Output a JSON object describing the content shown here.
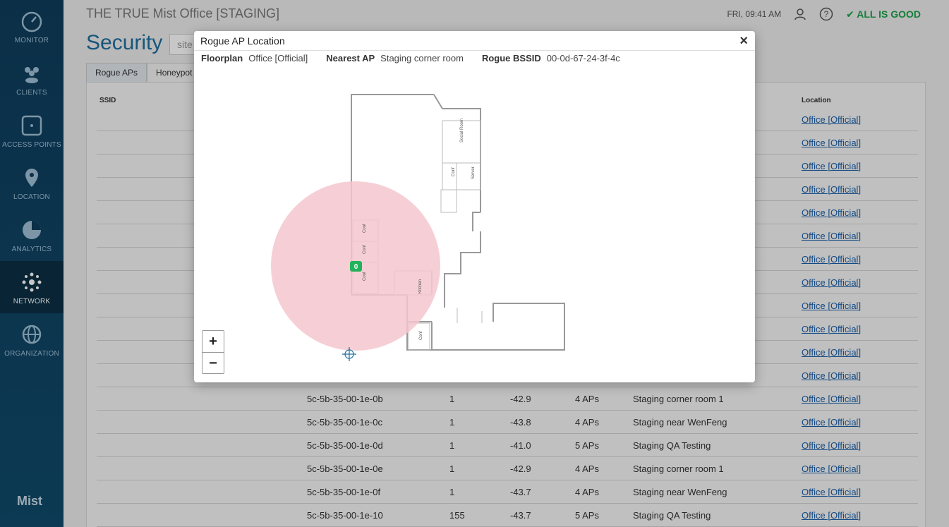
{
  "nav": [
    {
      "label": "MONITOR",
      "icon": "speedometer-icon"
    },
    {
      "label": "CLIENTS",
      "icon": "people-icon"
    },
    {
      "label": "ACCESS POINTS",
      "icon": "access-point-icon"
    },
    {
      "label": "LOCATION",
      "icon": "location-pin-icon"
    },
    {
      "label": "ANALYTICS",
      "icon": "pie-chart-icon"
    },
    {
      "label": "NETWORK",
      "icon": "network-icon"
    },
    {
      "label": "ORGANIZATION",
      "icon": "globe-icon"
    }
  ],
  "brand": "Mist",
  "header": {
    "site_title": "THE TRUE Mist Office [STAGING]",
    "datetime": "FRI, 09:41 AM",
    "status": "ALL IS GOOD"
  },
  "page": {
    "title": "Security",
    "site_placeholder": "site",
    "tabs": [
      "Rogue APs",
      "Honeypot"
    ]
  },
  "table": {
    "headers": {
      "ssid": "SSID",
      "location": "Location"
    },
    "rows": [
      {
        "bssid": "",
        "channel": "",
        "rssi": "",
        "aps": "",
        "closest": "",
        "location": "Office [Official]"
      },
      {
        "bssid": "",
        "channel": "",
        "rssi": "",
        "aps": "",
        "closest": "",
        "location": "Office [Official]"
      },
      {
        "bssid": "",
        "channel": "",
        "rssi": "",
        "aps": "",
        "closest": "",
        "location": "Office [Official]"
      },
      {
        "bssid": "",
        "channel": "",
        "rssi": "",
        "aps": "",
        "closest": "",
        "location": "Office [Official]"
      },
      {
        "bssid": "",
        "channel": "",
        "rssi": "",
        "aps": "",
        "closest": "",
        "location": "Office [Official]"
      },
      {
        "bssid": "",
        "channel": "",
        "rssi": "",
        "aps": "",
        "closest": "",
        "location": "Office [Official]"
      },
      {
        "bssid": "",
        "channel": "",
        "rssi": "",
        "aps": "",
        "closest": "",
        "location": "Office [Official]"
      },
      {
        "bssid": "",
        "channel": "",
        "rssi": "",
        "aps": "",
        "closest": "",
        "location": "Office [Official]"
      },
      {
        "bssid": "",
        "channel": "",
        "rssi": "",
        "aps": "",
        "closest": "",
        "location": "Office [Official]"
      },
      {
        "bssid": "",
        "channel": "",
        "rssi": "",
        "aps": "",
        "closest": "",
        "location": "Office [Official]"
      },
      {
        "bssid": "",
        "channel": "",
        "rssi": "",
        "aps": "",
        "closest": "",
        "location": "Office [Official]"
      },
      {
        "bssid": "",
        "channel": "",
        "rssi": "",
        "aps": "",
        "closest": "",
        "location": "Office [Official]"
      },
      {
        "bssid": "5c-5b-35-00-1e-0b",
        "channel": "1",
        "rssi": "-42.9",
        "aps": "4 APs",
        "closest": "Staging corner room 1",
        "location": "Office [Official]"
      },
      {
        "bssid": "5c-5b-35-00-1e-0c",
        "channel": "1",
        "rssi": "-43.8",
        "aps": "4 APs",
        "closest": "Staging near WenFeng",
        "location": "Office [Official]"
      },
      {
        "bssid": "5c-5b-35-00-1e-0d",
        "channel": "1",
        "rssi": "-41.0",
        "aps": "5 APs",
        "closest": "Staging QA Testing",
        "location": "Office [Official]"
      },
      {
        "bssid": "5c-5b-35-00-1e-0e",
        "channel": "1",
        "rssi": "-42.9",
        "aps": "4 APs",
        "closest": "Staging corner room 1",
        "location": "Office [Official]"
      },
      {
        "bssid": "5c-5b-35-00-1e-0f",
        "channel": "1",
        "rssi": "-43.7",
        "aps": "4 APs",
        "closest": "Staging near WenFeng",
        "location": "Office [Official]"
      },
      {
        "bssid": "5c-5b-35-00-1e-10",
        "channel": "155",
        "rssi": "-43.7",
        "aps": "5 APs",
        "closest": "Staging QA Testing",
        "location": "Office [Official]"
      }
    ]
  },
  "modal": {
    "title": "Rogue AP Location",
    "floorplan_label": "Floorplan",
    "floorplan_value": "Office [Official]",
    "nearest_label": "Nearest AP",
    "nearest_value": "Staging corner room",
    "bssid_label": "Rogue BSSID",
    "bssid_value": "00-0d-67-24-3f-4c",
    "ap_marker": "0",
    "rooms": [
      "Conf",
      "Conf",
      "Conf",
      "Kitchen",
      "Conf",
      "Conf",
      "Server",
      "Social Room"
    ],
    "zoom_in": "+",
    "zoom_out": "−",
    "colors": {
      "range": "#f4c7cf",
      "marker": "#23b35b",
      "accent": "#1e6f9f"
    }
  }
}
